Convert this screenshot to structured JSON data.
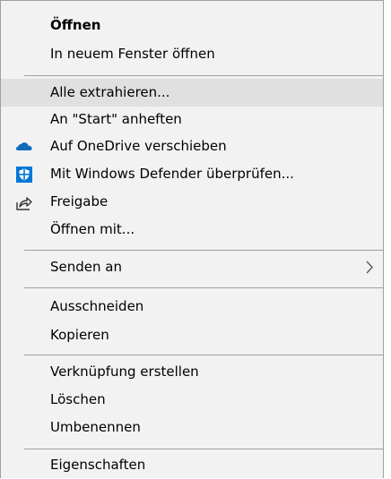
{
  "menu": {
    "items": [
      {
        "label": "Öffnen"
      },
      {
        "label": "In neuem Fenster öffnen"
      },
      {
        "label": "Alle extrahieren..."
      },
      {
        "label": "An \"Start\" anheften"
      },
      {
        "label": "Auf OneDrive verschieben",
        "icon": "onedrive-cloud-icon"
      },
      {
        "label": "Mit Windows Defender überprüfen...",
        "icon": "windows-defender-shield-icon"
      },
      {
        "label": "Freigabe",
        "icon": "share-icon"
      },
      {
        "label": "Öffnen mit..."
      },
      {
        "label": "Senden an",
        "icon": "chevron-right-icon"
      },
      {
        "label": "Ausschneiden"
      },
      {
        "label": "Kopieren"
      },
      {
        "label": "Verknüpfung erstellen"
      },
      {
        "label": "Löschen"
      },
      {
        "label": "Umbenennen"
      },
      {
        "label": "Eigenschaften"
      }
    ],
    "highlighted_item": "Alle extrahieren...",
    "colors": {
      "background": "#f2f2f2",
      "highlight": "#e0e0e0",
      "separator": "#a0a0a0",
      "onedrive": "#0f6cbd",
      "defender": "#0078d7"
    }
  }
}
